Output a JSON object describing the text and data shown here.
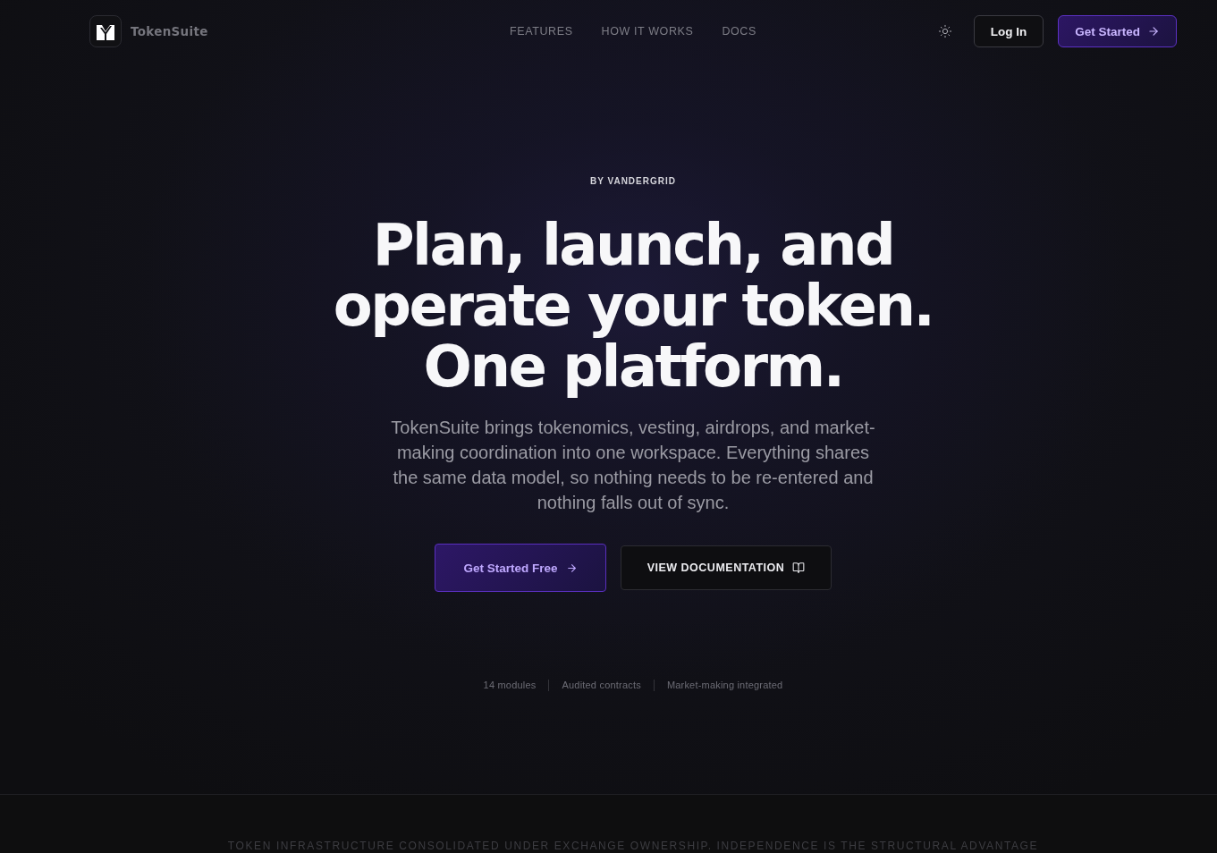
{
  "nav": {
    "brand": "TokenSuite",
    "links": [
      {
        "label": "FEATURES"
      },
      {
        "label": "HOW IT WORKS"
      },
      {
        "label": "DOCS"
      }
    ],
    "login": "Log In",
    "cta": "Get Started"
  },
  "hero": {
    "eyebrow": "BY VANDERGRID",
    "title_lines": [
      "Plan, launch, and",
      "operate your token.",
      "One platform."
    ],
    "description": "TokenSuite brings tokenomics, vesting, airdrops, and market-making coordination into one workspace. Everything shares the same data model, so nothing needs to be re-entered and nothing falls out of sync.",
    "primary_button": "Get Started Free",
    "secondary_button": "VIEW DOCUMENTATION",
    "stats": [
      "14 modules",
      "Audited contracts",
      "Market-making integrated"
    ]
  },
  "banner": {
    "text": "TOKEN INFRASTRUCTURE CONSOLIDATED UNDER EXCHANGE OWNERSHIP. INDEPENDENCE IS THE STRUCTURAL ADVANTAGE"
  }
}
